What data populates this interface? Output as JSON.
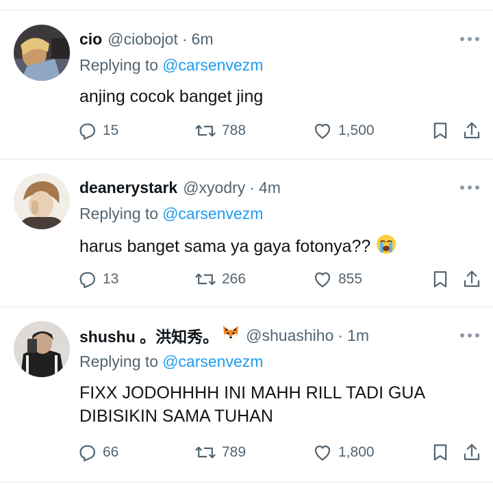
{
  "replying_prefix": "Replying to",
  "tweets": [
    {
      "name": "cio",
      "handle": "@ciobojot",
      "time": "6m",
      "replying_to": "@carsenvezm",
      "text": "anjing cocok banget jing",
      "replies": "15",
      "retweets": "788",
      "likes": "1,500"
    },
    {
      "name": "deanerystark",
      "handle": "@xyodry",
      "time": "4m",
      "replying_to": "@carsenvezm",
      "text": "harus banget sama ya gaya fotonya??",
      "emoji": "crying-face",
      "replies": "13",
      "retweets": "266",
      "likes": "855"
    },
    {
      "name": "shushu 。洪知秀。",
      "name_emoji": "fox-face",
      "handle": "@shuashiho",
      "time": "1m",
      "replying_to": "@carsenvezm",
      "text": "FIXX JODOHHHH INI MAHH RILL TADI GUA DIBISIKIN SAMA TUHAN",
      "replies": "66",
      "retweets": "789",
      "likes": "1,800"
    }
  ],
  "colors": {
    "link": "#1d9bf0",
    "secondary_text": "#536471",
    "divider": "#e1e8ed"
  },
  "separator_dot": "·"
}
